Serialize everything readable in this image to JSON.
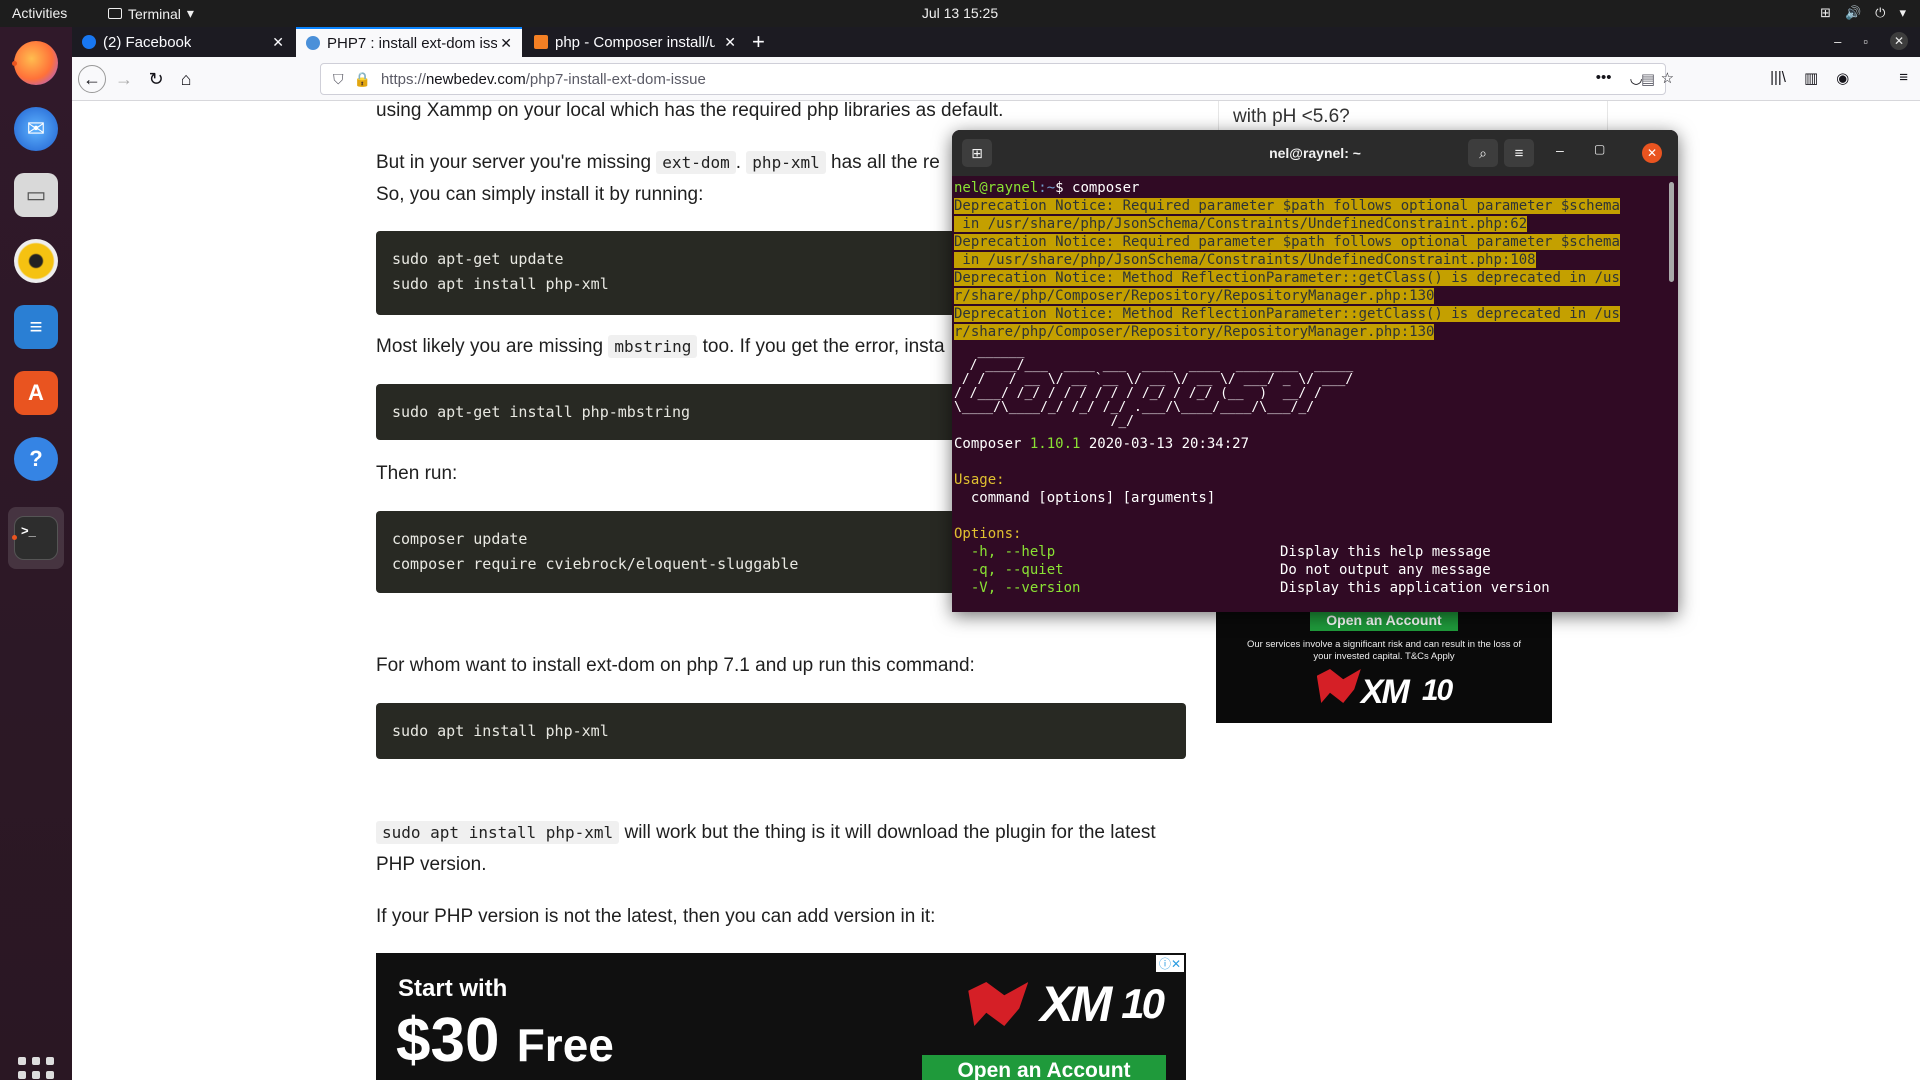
{
  "topbar": {
    "activities": "Activities",
    "app_name": "Terminal",
    "clock": "Jul 13  15:25"
  },
  "dock": {
    "apps": [
      "Firefox",
      "Thunderbird",
      "Files",
      "Rhythmbox",
      "LibreOffice Writer",
      "Ubuntu Software",
      "Help",
      "Terminal"
    ]
  },
  "browser": {
    "tabs": [
      {
        "title": "(2) Facebook"
      },
      {
        "title": "PHP7 : install ext-dom iss"
      },
      {
        "title": "php - Composer install/u"
      }
    ],
    "url_scheme": "https://",
    "url_host": "newbedev.com",
    "url_path": "/php7-install-ext-dom-issue"
  },
  "article": {
    "line_top": "using Xammp on your local which has the required php libraries as default.",
    "p1_a": "But in your server you're missing",
    "p1_code1": "ext-dom",
    "p1_dot": ".",
    "p1_code2": "php-xml",
    "p1_b": "has all the re",
    "p1_c": "So, you can simply install it by running:",
    "code1": [
      "sudo apt-get update",
      "sudo apt install php-xml"
    ],
    "p2_a": "Most likely you are missing",
    "p2_code": "mbstring",
    "p2_b": "too. If you get the error, insta",
    "code2": [
      "sudo apt-get install php-mbstring"
    ],
    "p3": "Then run:",
    "code3": [
      "composer update",
      "composer require cviebrock/eloquent-sluggable"
    ],
    "p4": "For whom want to install ext-dom on php 7.1 and up run this command:",
    "code4": [
      "sudo apt install php-xml"
    ],
    "p5_code": "sudo apt install php-xml",
    "p5_a": "will work but the thing is it will download the plugin for the latest",
    "p5_b": "PHP version.",
    "p6": "If your PHP version is not the latest, then you can add version in it:"
  },
  "sidebar": {
    "fragment": "with pH <5.6?"
  },
  "ads": {
    "side_button": "Open an Account",
    "side_disclaimer": "Our services involve a significant risk and can result in the loss of your invested capital. T&Cs Apply",
    "brand": "XM",
    "ten": "10",
    "bottom_line1": "Start with",
    "bottom_amount": "$30",
    "bottom_free": "Free",
    "bottom_button": "Open an Account"
  },
  "terminal": {
    "title": "nel@raynel: ~",
    "prompt_user": "nel@raynel",
    "prompt_path": ":~",
    "prompt_sym": "$ ",
    "command": "composer",
    "notices": [
      "Deprecation Notice: Required parameter $path follows optional parameter $schema",
      " in /usr/share/php/JsonSchema/Constraints/UndefinedConstraint.php:62",
      "Deprecation Notice: Required parameter $path follows optional parameter $schema",
      " in /usr/share/php/JsonSchema/Constraints/UndefinedConstraint.php:108",
      "Deprecation Notice: Method ReflectionParameter::getClass() is deprecated in /us",
      "r/share/php/Composer/Repository/RepositoryManager.php:130",
      "Deprecation Notice: Method ReflectionParameter::getClass() is deprecated in /us",
      "r/share/php/Composer/Repository/RepositoryManager.php:130"
    ],
    "logo": "   ______\n  / ____/___  ____ ___  ____  ____  ________  _____\n / /   / __ \\/ __ `__ \\/ __ \\/ __ \\/ ___/ _ \\/ ___/\n/ /___/ /_/ / / / / / / /_/ / /_/ (__  )  __/ /\n\\____/\\____/_/ /_/ /_/ .___/\\____/____/\\___/_/\n                    /_/",
    "version_label": "Composer ",
    "version": "1.10.1",
    "version_date": " 2020-03-13 20:34:27",
    "usage_label": "Usage:",
    "usage": "  command [options] [arguments]",
    "options_label": "Options:",
    "options": [
      {
        "flag": "  -h, --help",
        "desc": "Display this help message"
      },
      {
        "flag": "  -q, --quiet",
        "desc": "Do not output any message"
      },
      {
        "flag": "  -V, --version",
        "desc": "Display this application version"
      }
    ]
  }
}
